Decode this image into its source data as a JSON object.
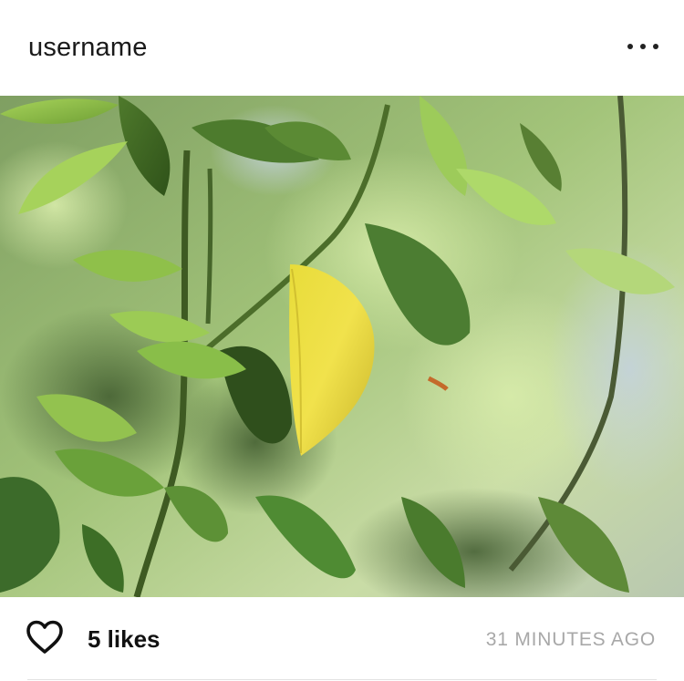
{
  "post": {
    "username": "username",
    "likes_label": "5 likes",
    "timestamp": "31 MINUTES AGO",
    "photo_alt": ""
  },
  "icons": {
    "menu": "more-horizontal-icon",
    "like": "heart-outline-icon"
  },
  "colors": {
    "text": "#111111",
    "muted": "#a8a8a8",
    "divider": "#e2e2e2",
    "background": "#ffffff"
  }
}
